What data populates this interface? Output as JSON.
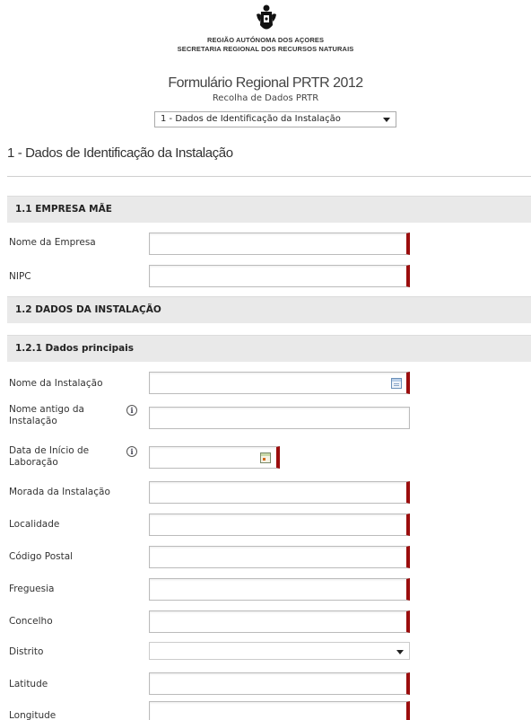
{
  "header": {
    "region_line1": "REGIÃO AUTÓNOMA DOS AÇORES",
    "region_line2": "SECRETARIA REGIONAL DOS RECURSOS NATURAIS",
    "form_title": "Formulário Regional PRTR 2012",
    "form_subtitle": "Recolha de Dados PRTR",
    "section_select": "1 - Dados de Identificação da Instalação"
  },
  "page_heading": "1 - Dados de Identificação da Instalação",
  "sections": {
    "empresa_mae": "1.1 EMPRESA MÃE",
    "dados_instalacao": "1.2 DADOS DA INSTALAÇÃO",
    "dados_principais": "1.2.1 Dados principais"
  },
  "fields": {
    "nome_empresa": "Nome da Empresa",
    "nipc": "NIPC",
    "nome_instalacao": "Nome da Instalação",
    "nome_antigo": "Nome antigo da Instalação",
    "data_inicio": "Data de Início de Laboração",
    "morada": "Morada da Instalação",
    "localidade": "Localidade",
    "codigo_postal": "Código Postal",
    "freguesia": "Freguesia",
    "concelho": "Concelho",
    "distrito": "Distrito",
    "latitude": "Latitude",
    "longitude": "Longitude"
  },
  "values": {
    "distrito": ""
  },
  "info_glyph": "i",
  "colors": {
    "required_marker": "#9b0d0d",
    "band_bg": "#e9e9e9"
  }
}
